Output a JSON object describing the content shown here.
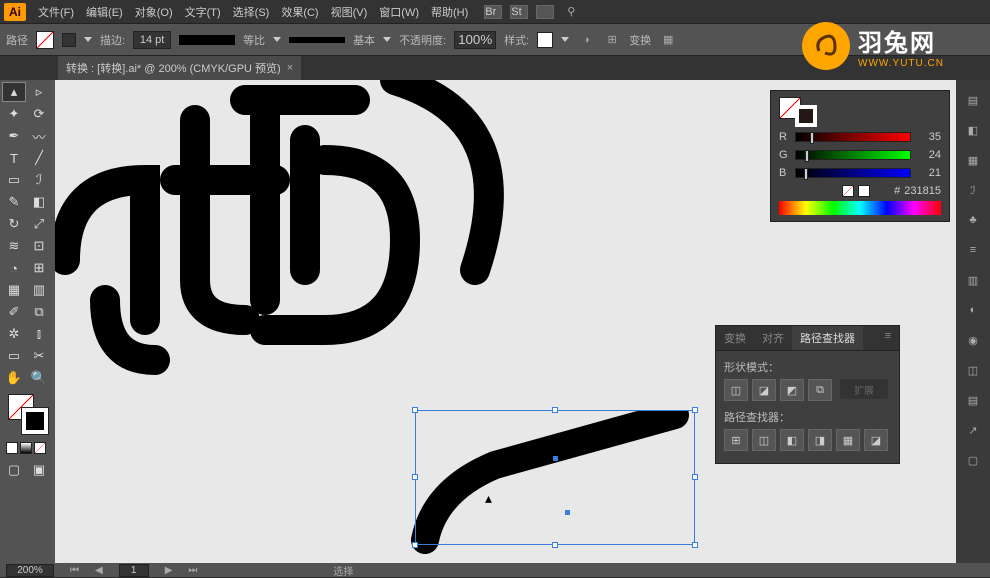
{
  "app_logo": "Ai",
  "menu": {
    "file": "文件(F)",
    "edit": "编辑(E)",
    "object": "对象(O)",
    "type": "文字(T)",
    "select": "选择(S)",
    "effect": "效果(C)",
    "view": "视图(V)",
    "window": "窗口(W)",
    "help": "帮助(H)"
  },
  "controlbar": {
    "label_path": "路径",
    "stroke_label": "描边:",
    "stroke_width": "14 pt",
    "uniform": "等比",
    "basic": "基本",
    "opacity_label": "不透明度:",
    "opacity_value": "100%",
    "style_label": "样式:",
    "transform": "变换"
  },
  "document_tab": {
    "title": "转换 : [转换].ai* @ 200% (CMYK/GPU 预览)",
    "close": "×"
  },
  "color_panel": {
    "r_label": "R",
    "g_label": "G",
    "b_label": "B",
    "r_val": "35",
    "g_val": "24",
    "b_val": "21",
    "hex": "231815"
  },
  "pathfinder": {
    "tab_transform": "变换",
    "tab_align": "对齐",
    "tab_pathfinder": "路径查找器",
    "shape_mode_label": "形状模式：",
    "pathfinder_label": "路径查找器：",
    "expand": "扩展"
  },
  "statusbar": {
    "zoom": "200%",
    "nav_value": "1",
    "tool_name": "选择"
  },
  "watermark": {
    "title": "羽兔网",
    "url": "WWW.YUTU.CN"
  }
}
